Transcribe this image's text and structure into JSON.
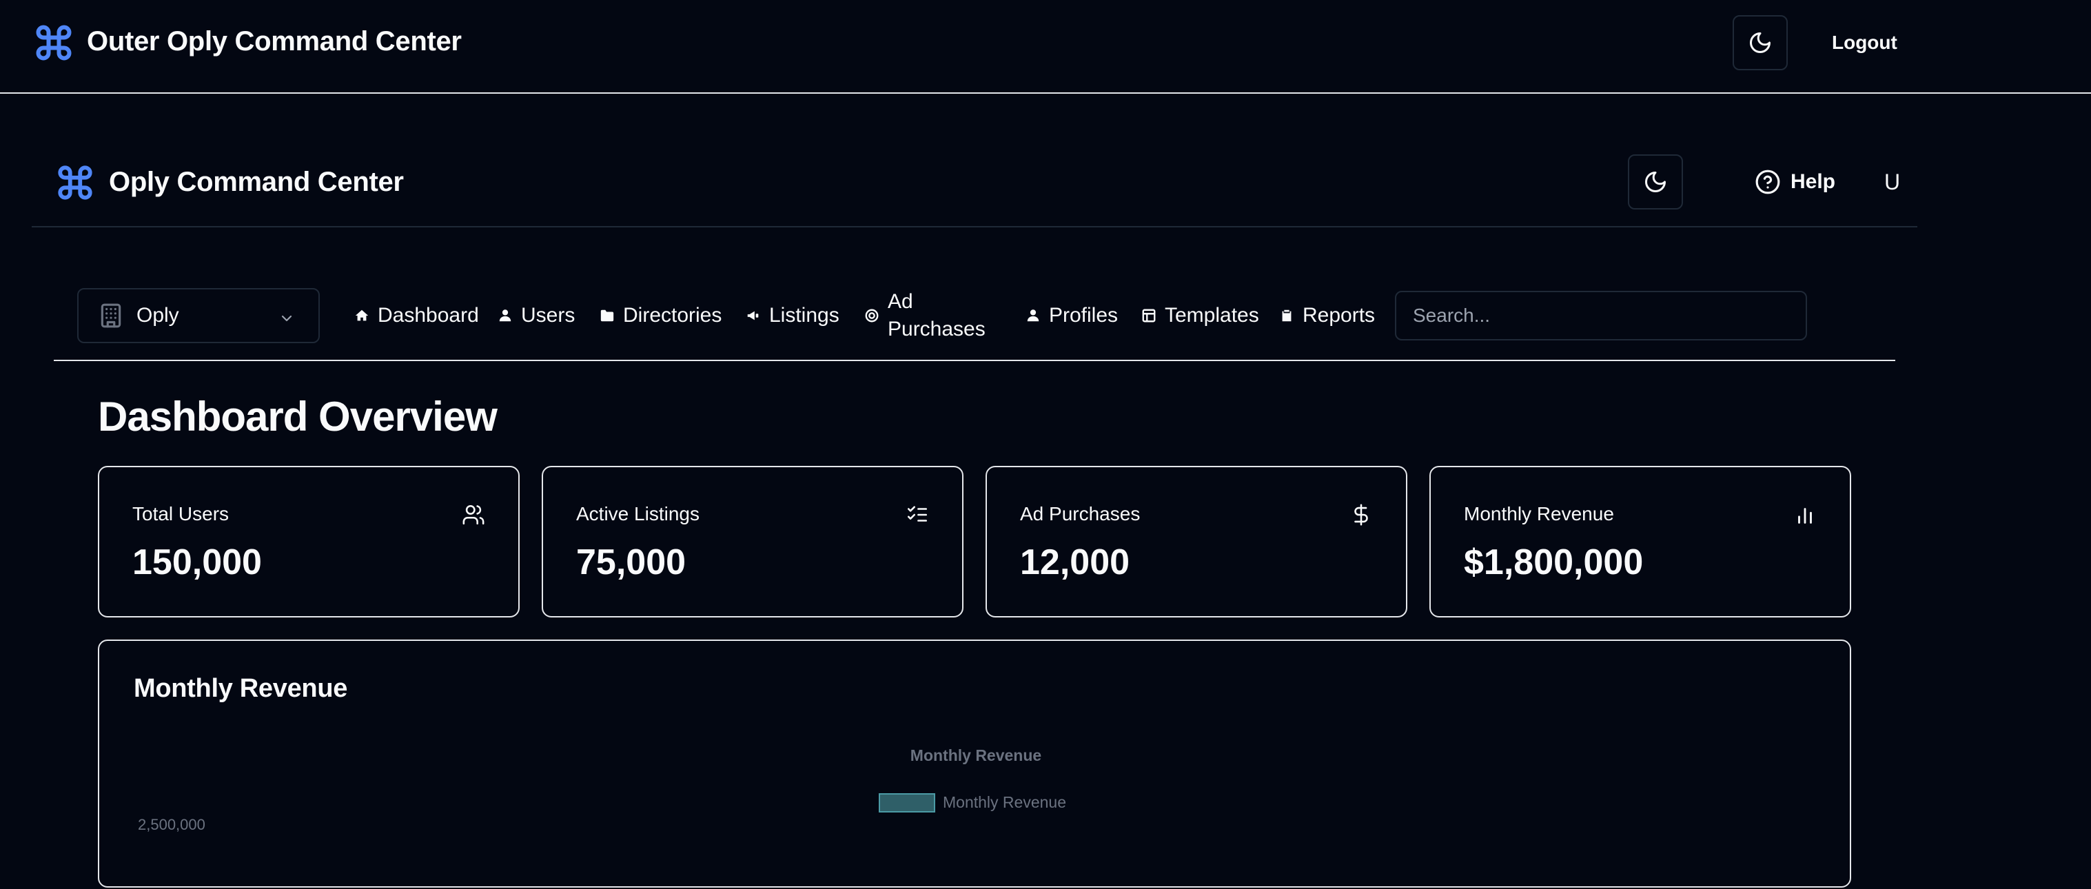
{
  "outer": {
    "title": "Outer Oply Command Center",
    "logo_icon": "command-icon",
    "theme_icon": "moon-icon",
    "logout_label": "Logout"
  },
  "inner": {
    "title": "Oply Command Center",
    "logo_icon": "command-icon",
    "theme_icon": "moon-icon",
    "help_label": "Help",
    "user_initial": "U"
  },
  "nav": {
    "org_select": {
      "selected": "Oply",
      "icon": "building-icon"
    },
    "items": [
      {
        "label": "Dashboard",
        "icon": "home-icon"
      },
      {
        "label": "Users",
        "icon": "user-icon"
      },
      {
        "label": "Directories",
        "icon": "folder-icon"
      },
      {
        "label": "Listings",
        "icon": "megaphone-icon"
      },
      {
        "label": "Ad Purchases",
        "icon": "target-icon"
      },
      {
        "label": "Profiles",
        "icon": "user-icon"
      },
      {
        "label": "Templates",
        "icon": "layout-icon"
      },
      {
        "label": "Reports",
        "icon": "clipboard-icon"
      }
    ],
    "search_placeholder": "Search..."
  },
  "page": {
    "title": "Dashboard Overview"
  },
  "stats": [
    {
      "label": "Total Users",
      "value": "150,000",
      "icon": "users-icon"
    },
    {
      "label": "Active Listings",
      "value": "75,000",
      "icon": "list-checks-icon"
    },
    {
      "label": "Ad Purchases",
      "value": "12,000",
      "icon": "dollar-icon"
    },
    {
      "label": "Monthly Revenue",
      "value": "$1,800,000",
      "icon": "bar-chart-icon"
    }
  ],
  "chart_card": {
    "heading": "Monthly Revenue"
  },
  "chart_data": {
    "type": "bar",
    "title": "Monthly Revenue",
    "legend": [
      "Monthly Revenue"
    ],
    "series": [
      {
        "name": "Monthly Revenue",
        "values": []
      }
    ],
    "y_ticks_visible": [
      "2,500,000"
    ],
    "colors": {
      "bar_fill": "#2f5f68",
      "bar_stroke": "#4b9aa5",
      "text": "#6b7280"
    }
  },
  "colors": {
    "background": "#030712",
    "accent": "#3b82f6",
    "border": "#1f2937",
    "card_border": "#e5e7eb"
  }
}
